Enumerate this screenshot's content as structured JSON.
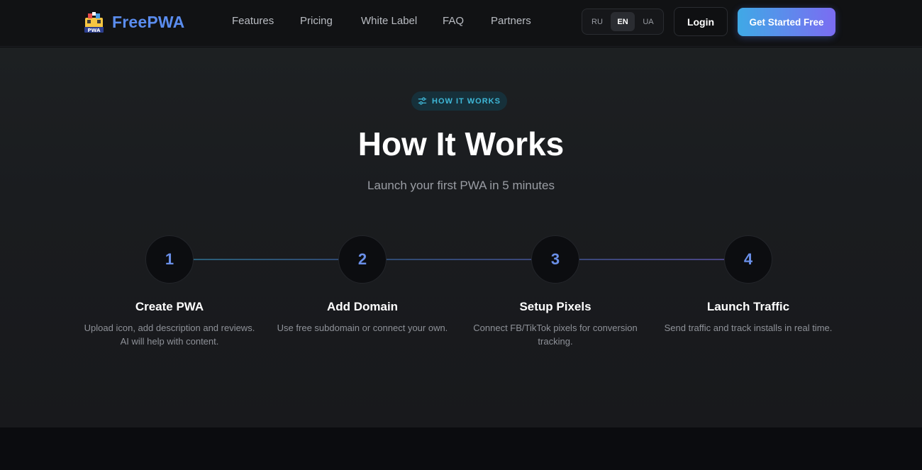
{
  "header": {
    "logo_text": "FreePWA",
    "logo_image_label": "PWA",
    "nav": [
      "Features",
      "Pricing",
      "White Label",
      "FAQ",
      "Partners"
    ],
    "languages": [
      "RU",
      "EN",
      "UA"
    ],
    "active_language": "EN",
    "login_label": "Login",
    "cta_label": "Get Started Free"
  },
  "section": {
    "badge": "HOW IT WORKS",
    "badge_icon": "sliders-icon",
    "title": "How It Works",
    "subtitle": "Launch your first PWA in 5 minutes",
    "steps": [
      {
        "number": "1",
        "title": "Create PWA",
        "description": "Upload icon, add description and reviews. AI will help with content."
      },
      {
        "number": "2",
        "title": "Add Domain",
        "description": "Use free subdomain or connect your own."
      },
      {
        "number": "3",
        "title": "Setup Pixels",
        "description": "Connect FB/TikTok pixels for conversion tracking."
      },
      {
        "number": "4",
        "title": "Launch Traffic",
        "description": "Send traffic and track installs in real time."
      }
    ]
  },
  "colors": {
    "brand": "#5b8def",
    "accent_badge": "#3fb8d8",
    "cta_gradient_start": "#3fa9e6",
    "cta_gradient_end": "#7b6cf2"
  }
}
